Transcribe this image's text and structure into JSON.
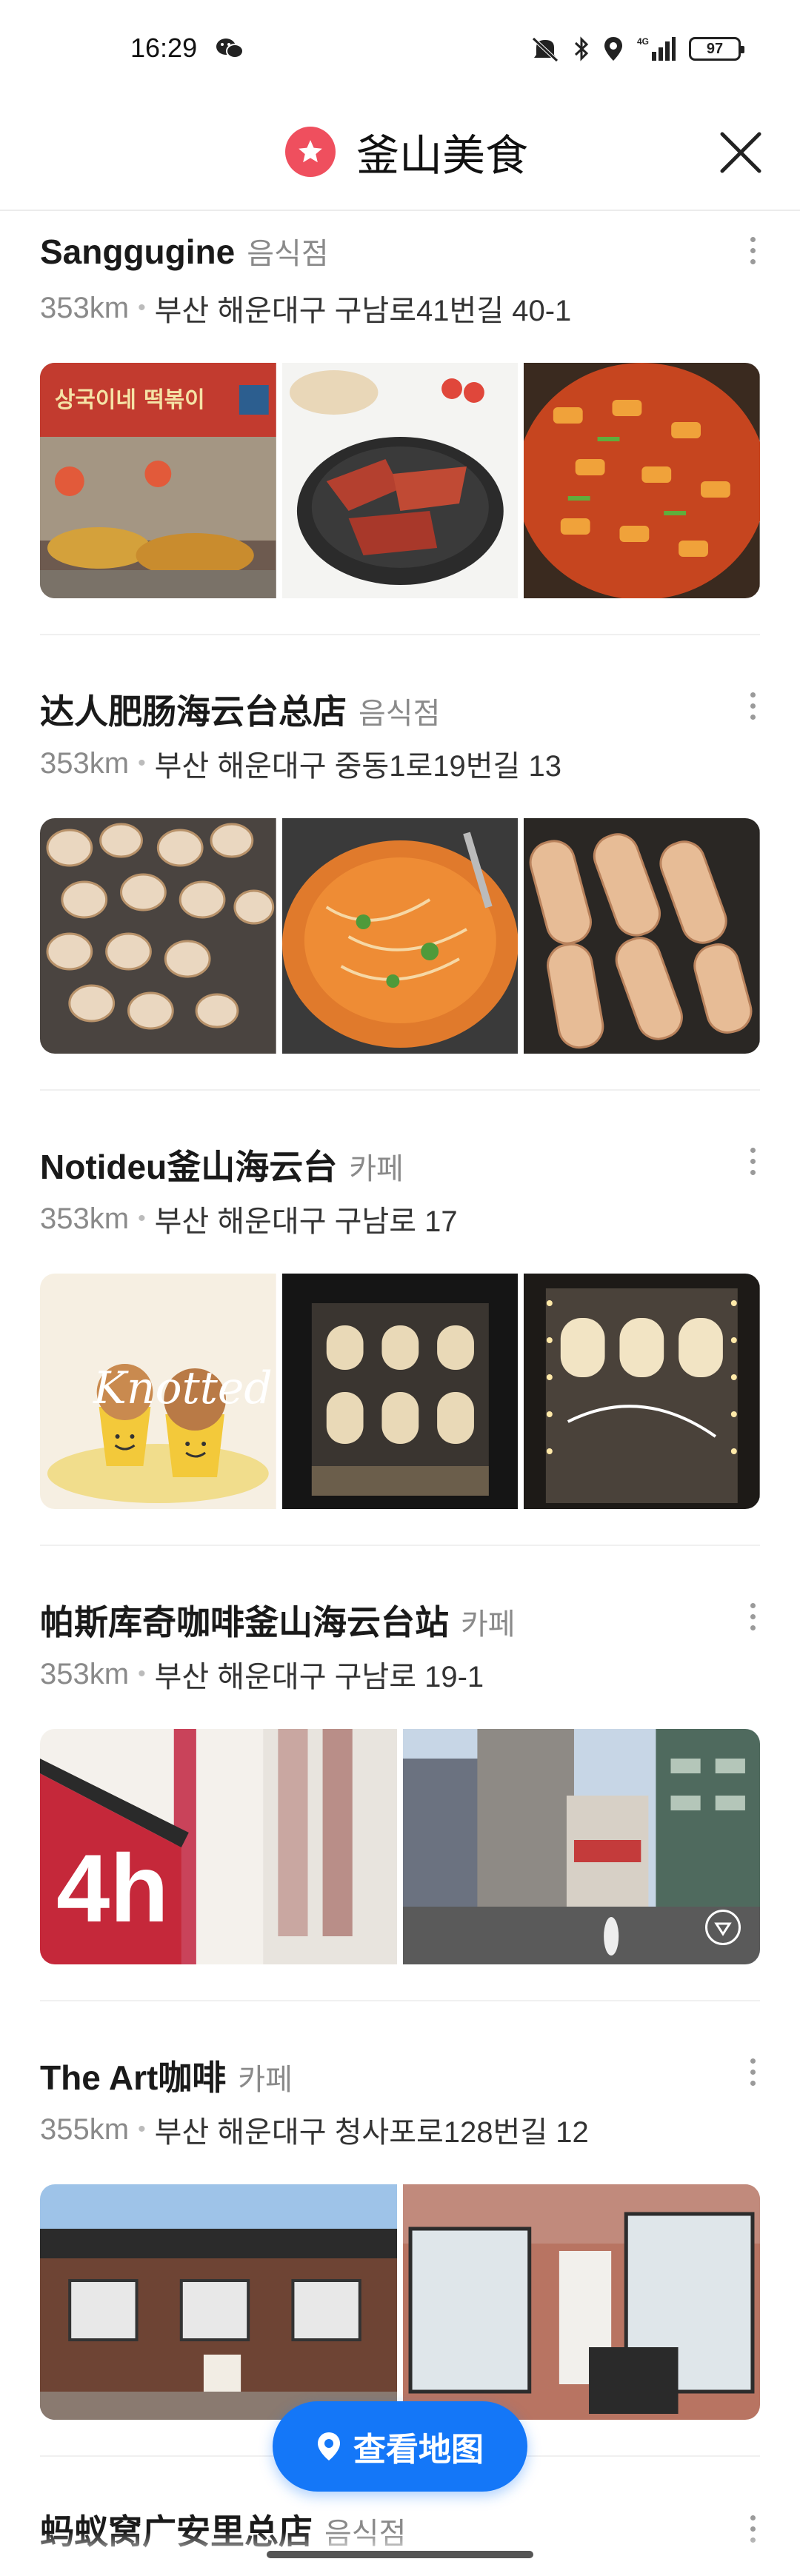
{
  "status_bar": {
    "time": "16:29",
    "battery": "97",
    "network": "4G",
    "icons": [
      "wechat-icon",
      "mute-icon",
      "bluetooth-icon",
      "location-icon",
      "signal-icon",
      "battery-icon"
    ]
  },
  "header": {
    "title": "釜山美食",
    "badge_icon": "star-icon",
    "badge_color": "#ef4f5e",
    "close_icon": "close-icon"
  },
  "places": [
    {
      "name": "Sanggugine",
      "category": "음식점",
      "distance": "353km",
      "address": "부산 해운대구 구남로41번길 40-1",
      "photos": [
        "restaurant-interior",
        "grilled-meat-plate",
        "tteokbokki-pan"
      ]
    },
    {
      "name": "达人肥肠海云台总店",
      "category": "음식점",
      "distance": "353km",
      "address": "부산 해운대구 중동1로19번길 13",
      "photos": [
        "grilled-intestines",
        "spicy-stew",
        "grilled-sausages"
      ]
    },
    {
      "name": "Notideu釜山海云台",
      "category": "카페",
      "distance": "353km",
      "address": "부산 해운대구 구남로 17",
      "photo_text": "Knotted",
      "photos": [
        "knotted-cups",
        "storefront-night",
        "storefront-lights"
      ]
    },
    {
      "name": "帕斯库奇咖啡釜山海云台站",
      "category": "카페",
      "distance": "353km",
      "address": "부산 해운대구 구남로 19-1",
      "photo_text": "4h",
      "photos": [
        "store-sign",
        "street-view"
      ]
    },
    {
      "name": "The Art咖啡",
      "category": "카페",
      "distance": "355km",
      "address": "부산 해운대구 청사포로128번길 12",
      "photos": [
        "brick-cafe-exterior",
        "cafe-windows"
      ]
    },
    {
      "name": "蚂蚁窝广安里总店",
      "category": "음식점"
    }
  ],
  "map_button": {
    "label": "查看地图",
    "icon": "location-pin-icon",
    "color": "#1477f8"
  }
}
